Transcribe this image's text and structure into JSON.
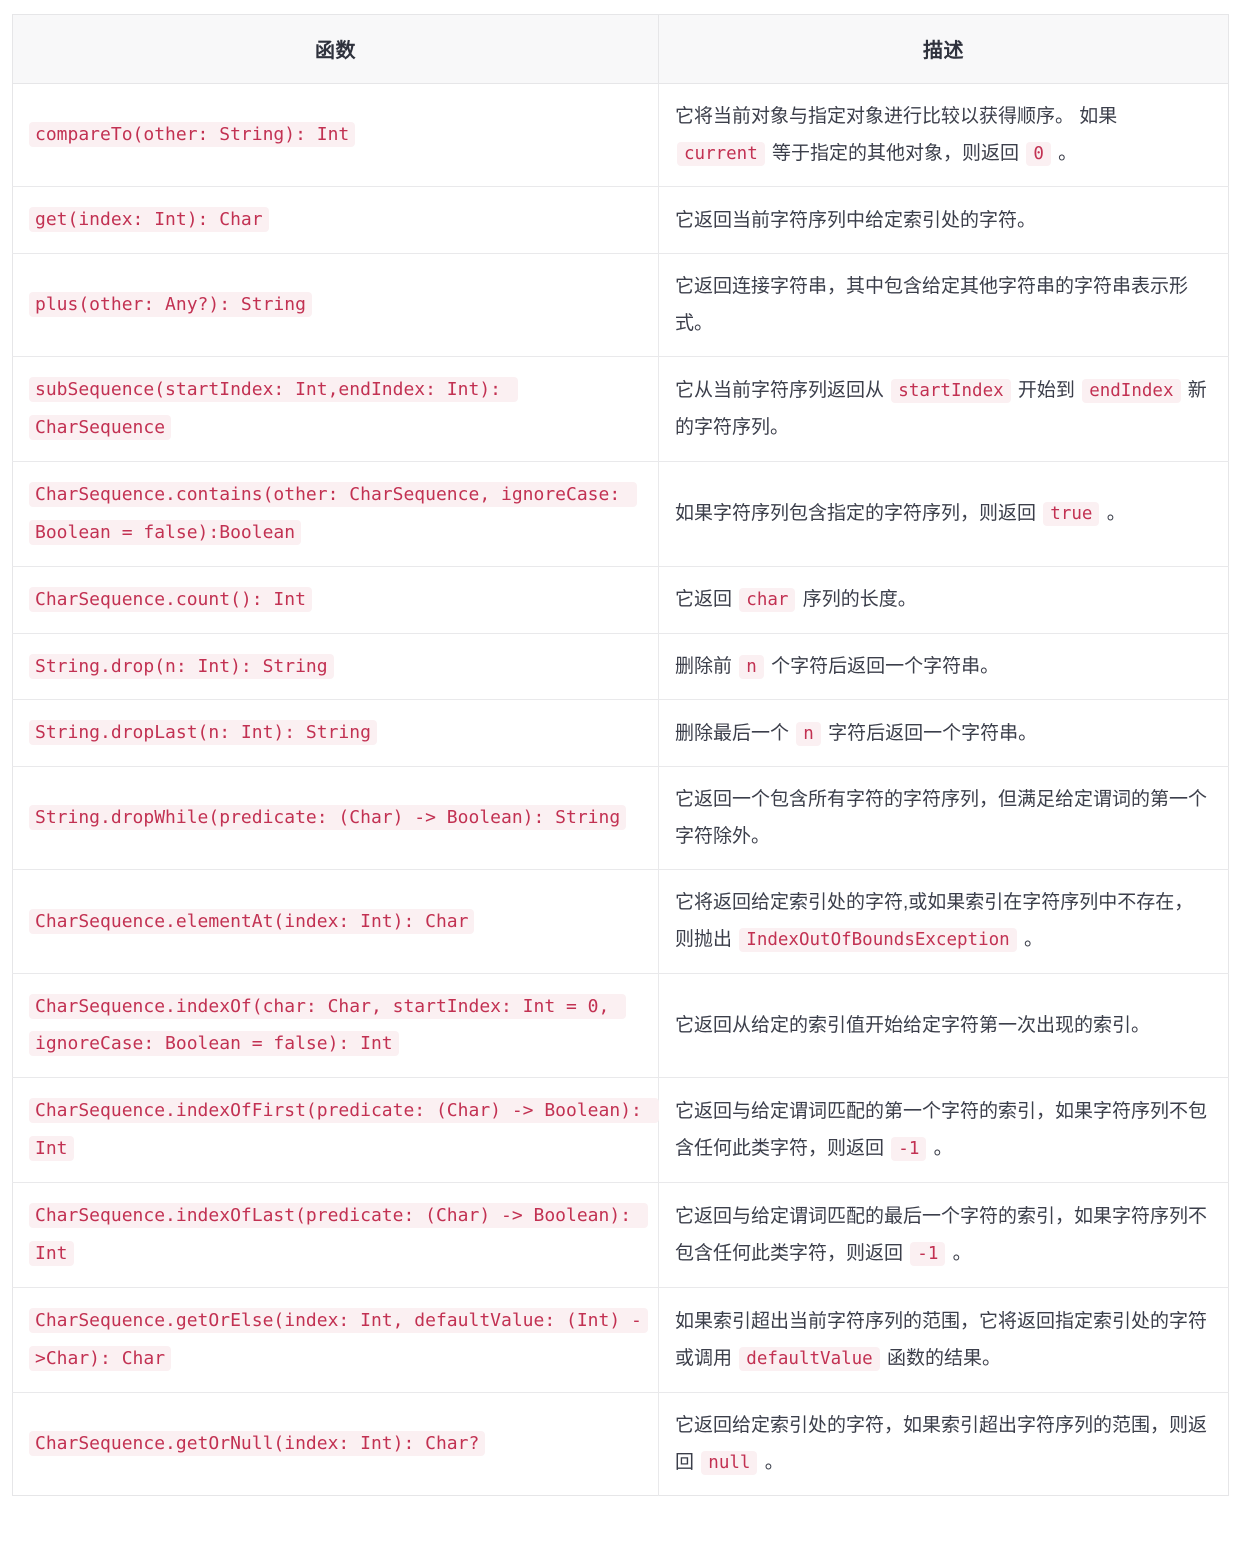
{
  "table": {
    "headers": {
      "function": "函数",
      "description": "描述"
    },
    "rows": [
      {
        "signature": "compareTo(other: String): Int",
        "desc_parts": [
          {
            "t": "text",
            "v": "它将当前对象与指定对象进行比较以获得顺序。 如果 "
          },
          {
            "t": "code",
            "v": "current"
          },
          {
            "t": "text",
            "v": " 等于指定的其他对象，则返回 "
          },
          {
            "t": "code",
            "v": "0"
          },
          {
            "t": "text",
            "v": " 。"
          }
        ]
      },
      {
        "signature": "get(index: Int): Char",
        "desc_parts": [
          {
            "t": "text",
            "v": "它返回当前字符序列中给定索引处的字符。"
          }
        ]
      },
      {
        "signature": "plus(other: Any?): String",
        "desc_parts": [
          {
            "t": "text",
            "v": "它返回连接字符串，其中包含给定其他字符串的字符串表示形式。"
          }
        ]
      },
      {
        "signature": "subSequence(startIndex: Int,endIndex: Int): CharSequence",
        "desc_parts": [
          {
            "t": "text",
            "v": "它从当前字符序列返回从 "
          },
          {
            "t": "code",
            "v": "startIndex"
          },
          {
            "t": "text",
            "v": " 开始到 "
          },
          {
            "t": "code",
            "v": "endIndex"
          },
          {
            "t": "text",
            "v": " 新的字符序列。"
          }
        ]
      },
      {
        "signature": "CharSequence.contains(other: CharSequence, ignoreCase: Boolean = false):Boolean",
        "desc_parts": [
          {
            "t": "text",
            "v": "如果字符序列包含指定的字符序列，则返回 "
          },
          {
            "t": "code",
            "v": "true"
          },
          {
            "t": "text",
            "v": " 。"
          }
        ]
      },
      {
        "signature": "CharSequence.count(): Int",
        "desc_parts": [
          {
            "t": "text",
            "v": "它返回 "
          },
          {
            "t": "code",
            "v": "char"
          },
          {
            "t": "text",
            "v": " 序列的长度。"
          }
        ]
      },
      {
        "signature": "String.drop(n: Int): String",
        "desc_parts": [
          {
            "t": "text",
            "v": "删除前 "
          },
          {
            "t": "code",
            "v": "n"
          },
          {
            "t": "text",
            "v": " 个字符后返回一个字符串。"
          }
        ]
      },
      {
        "signature": "String.dropLast(n: Int): String",
        "desc_parts": [
          {
            "t": "text",
            "v": "删除最后一个 "
          },
          {
            "t": "code",
            "v": "n"
          },
          {
            "t": "text",
            "v": " 字符后返回一个字符串。"
          }
        ]
      },
      {
        "signature": "String.dropWhile(predicate: (Char) -> Boolean): String",
        "desc_parts": [
          {
            "t": "text",
            "v": "它返回一个包含所有字符的字符序列，但满足给定谓词的第一个字符除外。"
          }
        ]
      },
      {
        "signature": "CharSequence.elementAt(index: Int): Char",
        "desc_parts": [
          {
            "t": "text",
            "v": "它将返回给定索引处的字符,或如果索引在字符序列中不存在，则抛出 "
          },
          {
            "t": "code",
            "v": "IndexOutOfBoundsException"
          },
          {
            "t": "text",
            "v": " 。"
          }
        ]
      },
      {
        "signature": "CharSequence.indexOf(char: Char, startIndex: Int = 0, ignoreCase: Boolean = false): Int",
        "desc_parts": [
          {
            "t": "text",
            "v": "它返回从给定的索引值开始给定字符第一次出现的索引。"
          }
        ]
      },
      {
        "signature": "CharSequence.indexOfFirst(predicate: (Char) -> Boolean): Int",
        "desc_parts": [
          {
            "t": "text",
            "v": "它返回与给定谓词匹配的第一个字符的索引，如果字符序列不包含任何此类字符，则返回 "
          },
          {
            "t": "code",
            "v": "-1"
          },
          {
            "t": "text",
            "v": " 。"
          }
        ]
      },
      {
        "signature": "CharSequence.indexOfLast(predicate: (Char) -> Boolean): Int",
        "desc_parts": [
          {
            "t": "text",
            "v": "它返回与给定谓词匹配的最后一个字符的索引，如果字符序列不包含任何此类字符，则返回 "
          },
          {
            "t": "code",
            "v": "-1"
          },
          {
            "t": "text",
            "v": " 。"
          }
        ]
      },
      {
        "signature": "CharSequence.getOrElse(index: Int, defaultValue: (Int) ->Char): Char",
        "desc_parts": [
          {
            "t": "text",
            "v": "如果索引超出当前字符序列的范围，它将返回指定索引处的字符或调用 "
          },
          {
            "t": "code",
            "v": "defaultValue"
          },
          {
            "t": "text",
            "v": " 函数的结果。"
          }
        ]
      },
      {
        "signature": "CharSequence.getOrNull(index: Int): Char?",
        "desc_parts": [
          {
            "t": "text",
            "v": "它返回给定索引处的字符，如果索引超出字符序列的范围，则返回 "
          },
          {
            "t": "code",
            "v": "null"
          },
          {
            "t": "text",
            "v": " 。"
          }
        ]
      }
    ]
  },
  "colors": {
    "code_text": "#c23152",
    "code_background": "#fbf0f2",
    "header_background": "#f8f8f9",
    "border": "#e6e6e8",
    "body_text": "#3b3e4a"
  }
}
